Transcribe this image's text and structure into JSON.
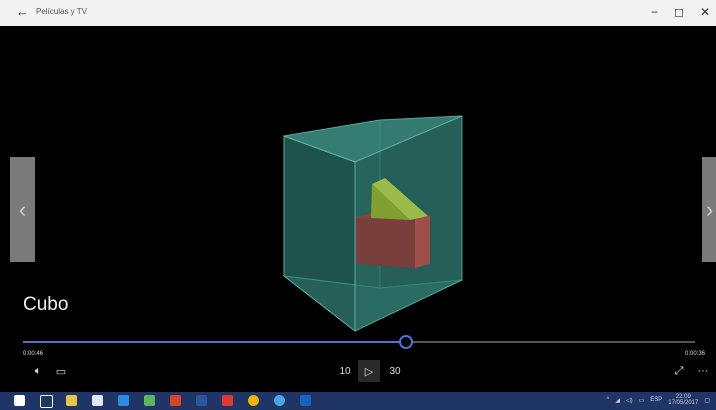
{
  "window": {
    "title": "Películas y TV",
    "back_icon": "arrow-left-icon",
    "controls": [
      "minimize-icon",
      "restore-icon",
      "close-icon"
    ]
  },
  "player": {
    "movie_title": "Cubo",
    "time_elapsed": "0:00:46",
    "time_remaining": "0:00:36",
    "progress_fraction": 0.57,
    "prev_icon": "chevron-left-icon",
    "next_icon": "chevron-right-icon",
    "controls": {
      "volume_icon": "volume-icon",
      "subtitles_icon": "subtitles-icon",
      "skip_back_label": "10",
      "play_icon": "play-icon",
      "skip_forward_label": "30",
      "fullscreen_icon": "expand-icon",
      "more_icon": "more-icon"
    },
    "colors": {
      "accent": "#4a74d6"
    }
  },
  "taskbar": {
    "tray_lang": "ESP",
    "clock_time": "22:09",
    "clock_date": "17/05/2017",
    "apps": [
      "windows-logo-icon",
      "task-view-icon",
      "file-explorer-icon",
      "store-icon",
      "edge-icon",
      "maps-icon",
      "powerpoint-icon",
      "word-icon",
      "app-icon",
      "chrome-icon",
      "internet-explorer-icon",
      "movies-tv-icon"
    ]
  }
}
